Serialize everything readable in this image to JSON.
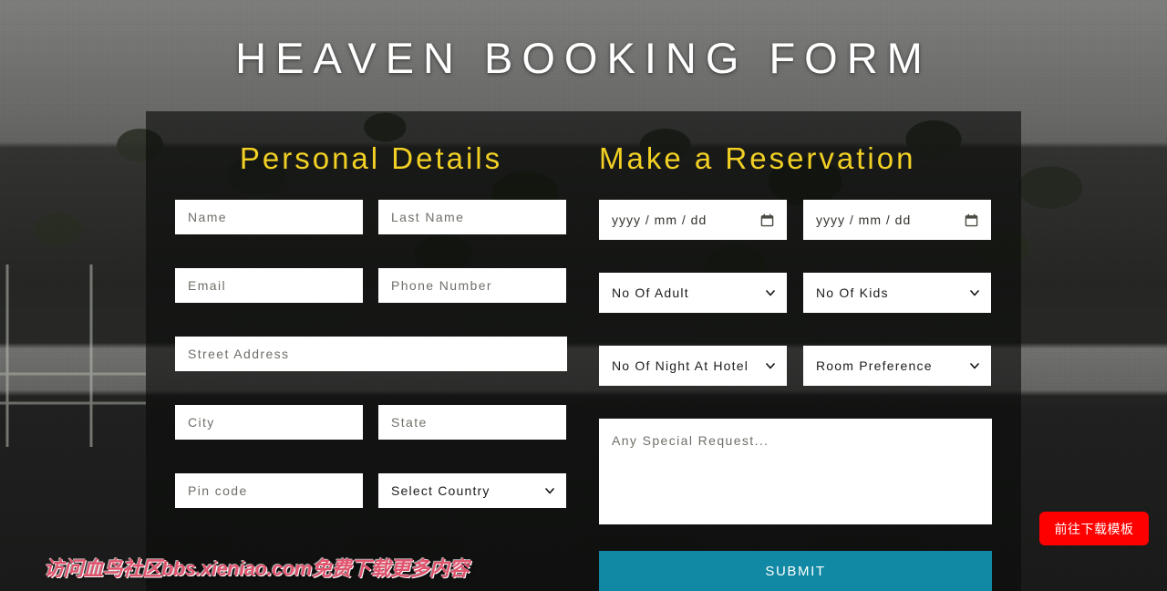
{
  "page": {
    "title": "HEAVEN BOOKING FORM",
    "background_description": "resort building with trees and pool, desaturated"
  },
  "colors": {
    "heading_yellow": "#f2d024",
    "submit_teal": "#1189a4",
    "download_red": "#fe0000",
    "watermark_pink": "#e0546e",
    "panel_overlay": "rgba(9,12,10,0.62)",
    "field_white": "#ffffff",
    "placeholder_gray": "#6f6f68"
  },
  "personal_details": {
    "heading": "Personal Details",
    "fields": {
      "name": "Name",
      "last_name": "Last Name",
      "email": "Email",
      "phone": "Phone Number",
      "street_address": "Street Address",
      "city": "City",
      "state": "State",
      "pin_code": "Pin code",
      "country_selected": "Select Country"
    }
  },
  "reservation": {
    "heading": "Make a Reservation",
    "fields": {
      "check_in_date": "yyyy / mm / dd",
      "check_out_date": "yyyy / mm / dd",
      "adults_selected": "No Of Adult",
      "kids_selected": "No Of Kids",
      "nights_selected": "No Of Night At Hotel",
      "room_preference_selected": "Room Preference",
      "special_request": "Any Special Request..."
    },
    "submit_label": "SUBMIT"
  },
  "overlays": {
    "watermark": "访问血鸟社区bbs.xieniao.com免费下载更多内容",
    "download_button": "前往下载模板"
  }
}
